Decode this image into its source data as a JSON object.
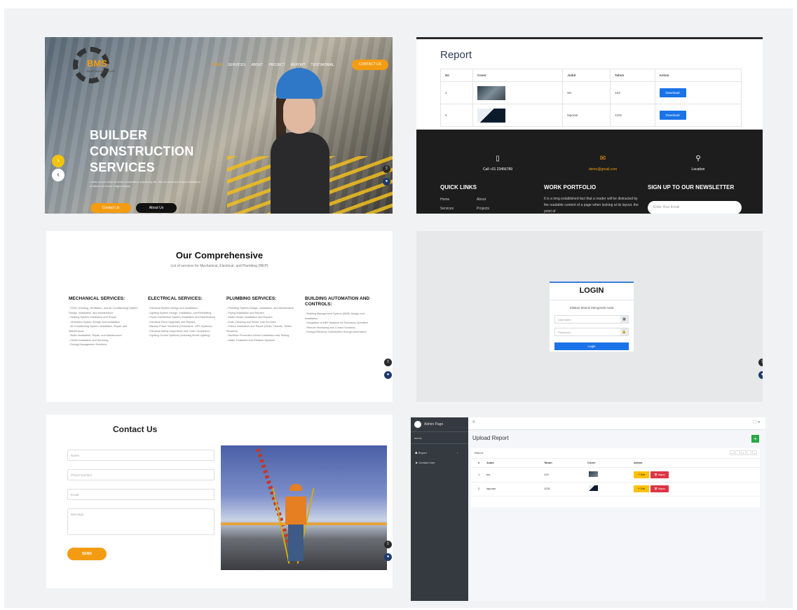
{
  "hero": {
    "logo_text": "BMS",
    "tagline": "BUMI MULIA SOLUSI",
    "nav": [
      "HOME",
      "SERVICES",
      "ABOUT",
      "PROJECT",
      "REPORT",
      "TESTIMONIAL"
    ],
    "cta": "CONTACT US",
    "title_lines": [
      "BUILDER",
      "CONSTRUCTION",
      "SERVICES"
    ],
    "lorem": "Lorem ipsum dolor sit amet consectetur adipiscing elit. Sed do eiusmod tempor incididunt ut labore et dolore magna aliqua.",
    "btn_contact": "Contact Us",
    "btn_about": "About Us",
    "arrow_next": "›",
    "arrow_prev": "‹",
    "fab_top": "⇧",
    "fab_chat": "●"
  },
  "report": {
    "title": "Report",
    "headers": [
      "No",
      "Cover",
      "Judul",
      "Tahun",
      "Action"
    ],
    "rows": [
      {
        "no": "1",
        "judul": "tes",
        "tahun": "123",
        "action": "Download"
      },
      {
        "no": "4",
        "judul": "laporan",
        "tahun": "1231",
        "action": "Download"
      }
    ],
    "footer": {
      "call": "Call +01 23456789",
      "email": "demo@gmail.com",
      "location": "Location",
      "phone_icon": "▯",
      "mail_icon": "✉",
      "pin_icon": "⚲",
      "quick_links": "QUICK LINKS",
      "links": [
        "Home",
        "About",
        "Services",
        "Projects"
      ],
      "portfolio": "WORK PORTFOLIO",
      "portfolio_text": "It is a long established fact that a reader will be distracted by the readable content of a page when looking at its layout. the point of",
      "newsletter": "SIGN UP TO OUR NEWSLETTER",
      "email_placeholder": "Enter Your Email"
    }
  },
  "services": {
    "title": "Our Comprehensive",
    "subtitle": "List of services for Mechanical, Electrical, and Plumbing (MEP)",
    "columns": [
      {
        "title": "MECHANICAL SERVICES:",
        "items": [
          "- HVAC (Heating, Ventilation, and Air Conditioning) System Design, Installation, and Maintenance",
          "- Heating System Installation and Repair",
          "- Ventilation System Design and Installation",
          "- Air Conditioning System Installation, Repair, and Maintenance",
          "- Boiler Installation, Repair, and Maintenance",
          "- Chiller Installation and Servicing",
          "- Energy Management Solutions"
        ]
      },
      {
        "title": "ELECTRICAL SERVICES:",
        "items": [
          "- Electrical System Design and Installation",
          "- Lighting System Design, Installation, and Retrofitting",
          "- Power Distribution System Installation and Maintenance",
          "- Electrical Panel Upgrades and Repairs",
          "- Backup Power Solutions (Generators, UPS Systems)",
          "- Electrical Safety Inspections and Code Compliance",
          "- Lighting Control Systems (including Smart Lighting)"
        ]
      },
      {
        "title": "PLUMBING SERVICES:",
        "items": [
          "- Plumbing System Design, Installation, and Maintenance",
          "- Piping Installation and Repairs",
          "- Water Heater Installation and Repairs",
          "- Drain Cleaning and Sewer Line Services",
          "- Fixture Installation and Repair (Sinks, Faucets, Toilets, Showers)",
          "- Backflow Prevention Device Installation and Testing",
          "- Water Treatment and Filtration Systems"
        ]
      },
      {
        "title": "BUILDING AUTOMATION AND CONTROLS:",
        "items": [
          "- Building Management System (BMS) Design and Installation",
          "- Integration of MEP Systems for Seamless Operation",
          "- Remote Monitoring and Control Solutions",
          "- Energy Efficiency Optimization through Automation"
        ]
      }
    ]
  },
  "login": {
    "title": "LOGIN",
    "subtitle": "Silakan Masuk Mengenali Anda",
    "username_placeholder": "Username",
    "password_placeholder": "Password",
    "user_icon": "▦",
    "lock_icon": "🔒",
    "button": "Login"
  },
  "contact": {
    "title": "Contact Us",
    "name_placeholder": "Name",
    "phone_placeholder": "Phone Number",
    "email_placeholder": "Email",
    "message_placeholder": "Message",
    "send": "SEND"
  },
  "admin": {
    "brand": "Admin Page",
    "user": "admin",
    "menu": [
      "Report",
      "Contact User"
    ],
    "menu_icons": [
      "☗",
      "☻"
    ],
    "hamburger": "≡",
    "top_right": "⛶  ⇥",
    "upload_title": "Upload Report",
    "add": "+",
    "card_title": "Report",
    "pager": [
      "«",
      "‹",
      "1",
      "›",
      "»"
    ],
    "headers": [
      "#",
      "Judul",
      "Tahun",
      "Cover",
      "Action"
    ],
    "rows": [
      {
        "no": "1",
        "judul": "tes",
        "tahun": "123"
      },
      {
        "no": "2",
        "judul": "laporan",
        "tahun": "1231"
      }
    ],
    "edit": "✎ Edit",
    "hapus": "🗑 Hapus"
  }
}
